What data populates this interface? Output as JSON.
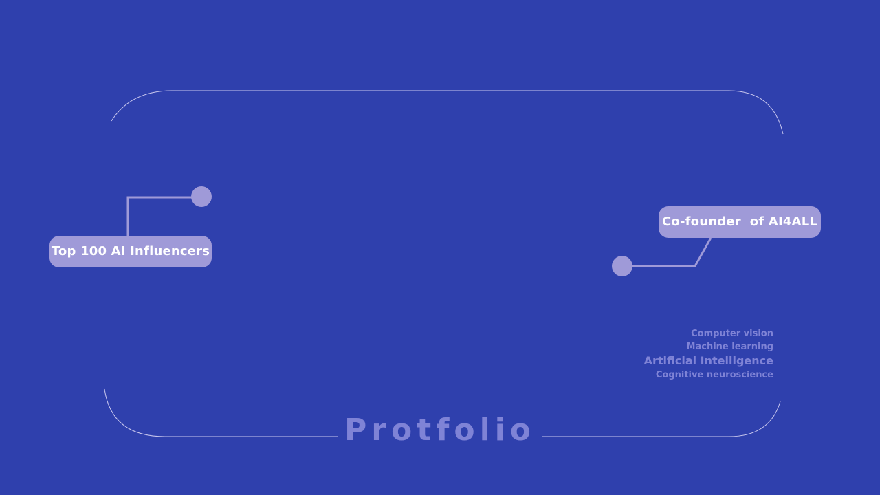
{
  "slide": {
    "title": "Protfolio",
    "highlights": [
      {
        "label": "Top 100 AI Influencers"
      },
      {
        "label": "Co-founder  of AI4ALL"
      }
    ],
    "skills": [
      "Computer vision",
      "Machine learning",
      "Artificial Intelligence",
      "Cognitive neuroscience"
    ]
  },
  "colors": {
    "background": "#2f40ad",
    "accent": "#9f9ad8",
    "muted_text": "#7f83d6",
    "outline": "#c9c7ee"
  }
}
